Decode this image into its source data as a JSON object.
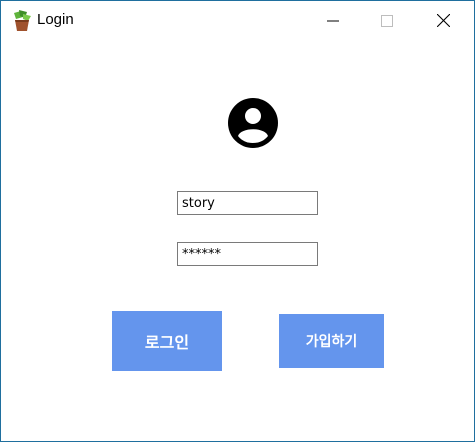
{
  "window": {
    "title": "Login",
    "app_icon": "plant-pot-icon",
    "controls": {
      "minimize_icon": "minimize-icon",
      "maximize_icon": "maximize-icon",
      "close_icon": "close-icon"
    }
  },
  "form": {
    "avatar_icon": "user-circle-icon",
    "username_value": "story",
    "password_masked_value": "******"
  },
  "buttons": {
    "login_label": "로그인",
    "signup_label": "가입하기"
  },
  "colors": {
    "button_bg": "#6495ed",
    "button_text": "#ffffff",
    "window_border": "#1f6f9e"
  }
}
